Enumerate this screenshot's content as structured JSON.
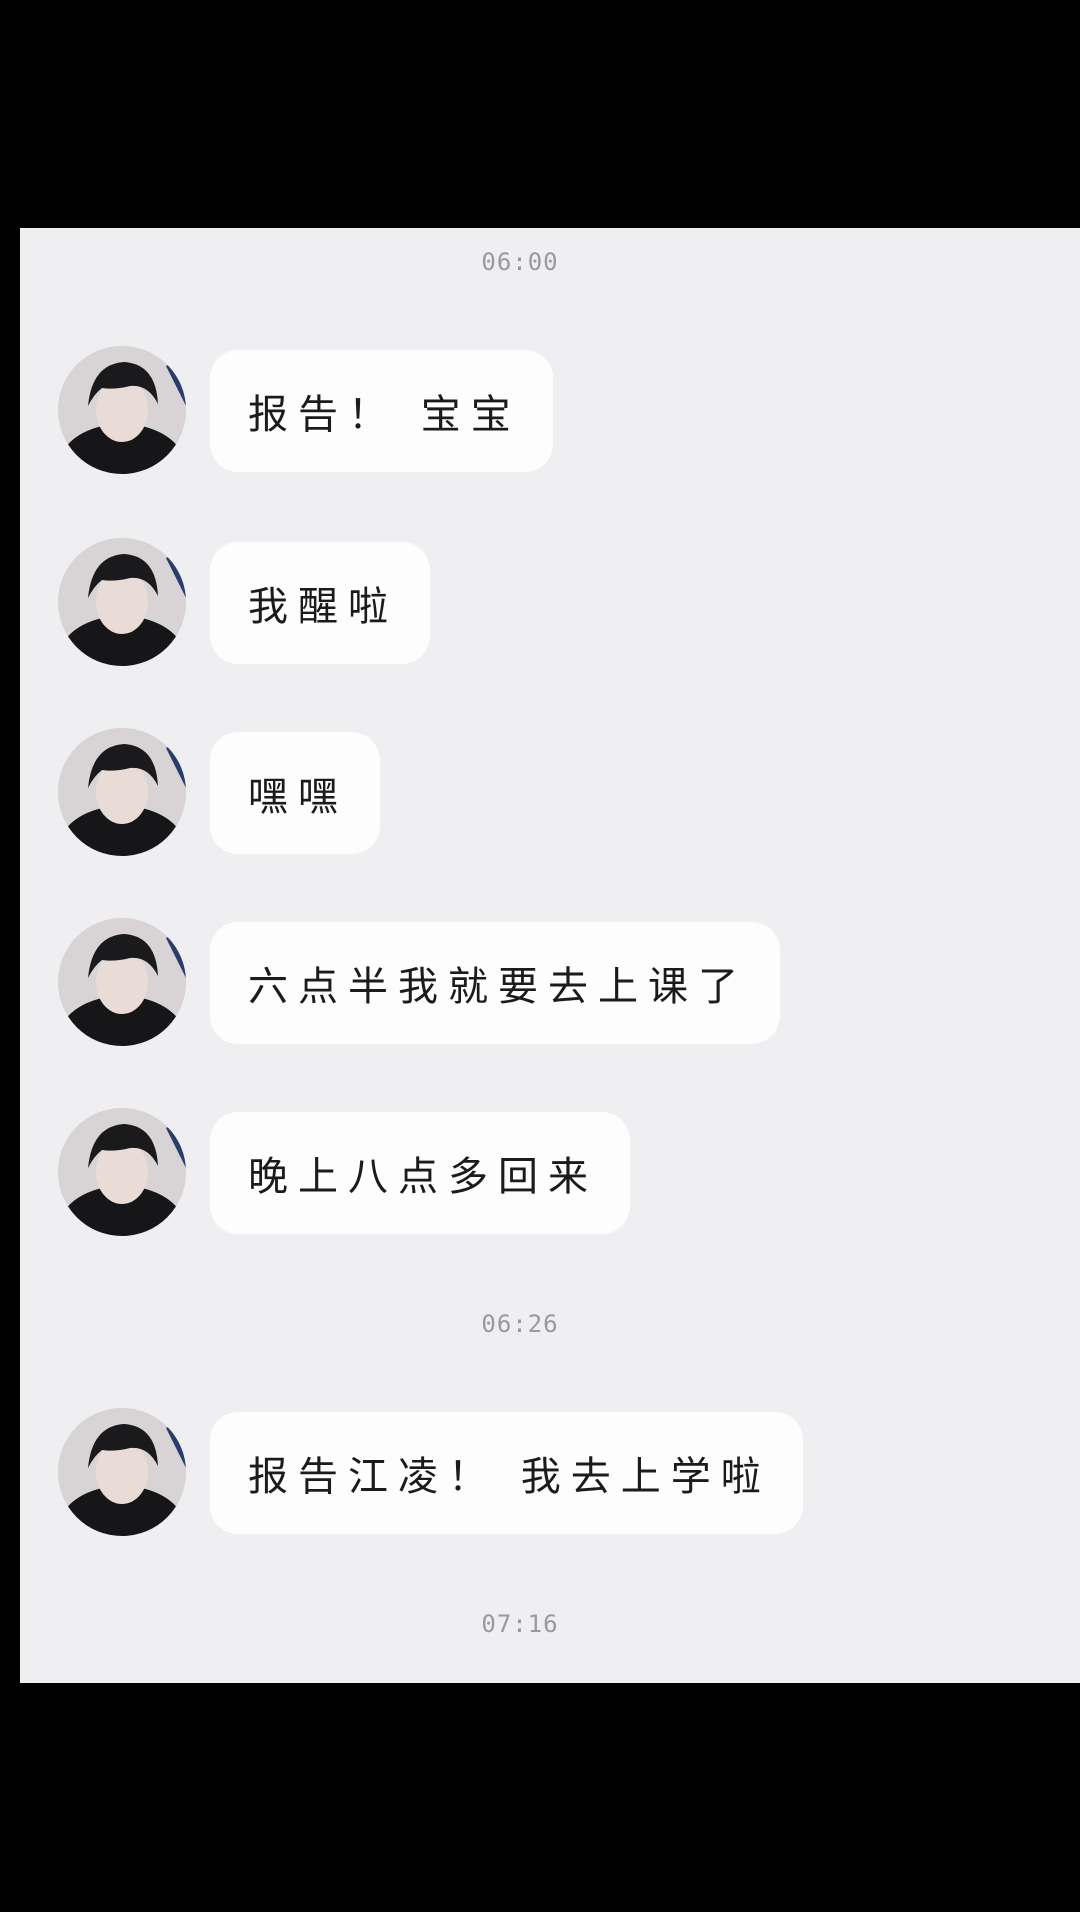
{
  "colors": {
    "background": "#000000",
    "chat_panel": "#efeff2",
    "bubble": "#fdfdfe",
    "text": "#1b1b1b",
    "timestamp": "#9a9a9e"
  },
  "timestamps": [
    "06:00",
    "06:26",
    "07:16"
  ],
  "messages": [
    {
      "text": "报告！ 宝宝",
      "avatar_icon": "user-avatar-icon"
    },
    {
      "text": "我醒啦",
      "avatar_icon": "user-avatar-icon"
    },
    {
      "text": "嘿嘿",
      "avatar_icon": "user-avatar-icon"
    },
    {
      "text": "六点半我就要去上课了",
      "avatar_icon": "user-avatar-icon"
    },
    {
      "text": "晚上八点多回来",
      "avatar_icon": "user-avatar-icon"
    },
    {
      "text": "报告江凌！ 我去上学啦",
      "avatar_icon": "user-avatar-icon"
    }
  ]
}
